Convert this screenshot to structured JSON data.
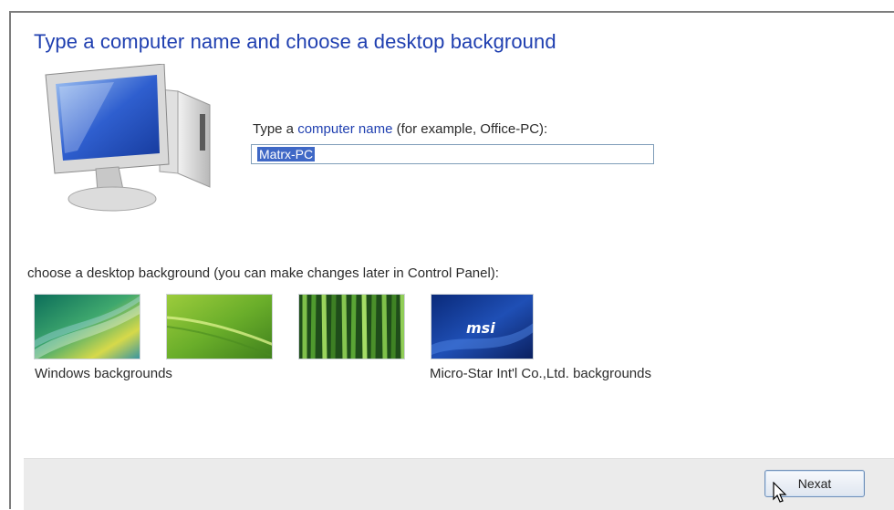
{
  "page": {
    "title": "Type a computer name and choose a desktop background"
  },
  "computer_name": {
    "prompt_prefix": "Type a ",
    "prompt_link": "computer name",
    "prompt_suffix": " (for example, Office-PC):",
    "value": "Matrx-PC"
  },
  "backgrounds": {
    "label": "choose a desktop background (you can make changes later in Control Panel):",
    "groups": [
      {
        "label": "Windows backgrounds"
      },
      {
        "label": "Micro-Star Int'l Co.,Ltd. backgrounds"
      }
    ],
    "msi_logo_text": "msi"
  },
  "footer": {
    "next_label": "Nexat"
  },
  "colors": {
    "title": "#1f3fb0",
    "link": "#1f3fb0",
    "selection": "#3f68c6",
    "footer_bg": "#ebebeb"
  }
}
